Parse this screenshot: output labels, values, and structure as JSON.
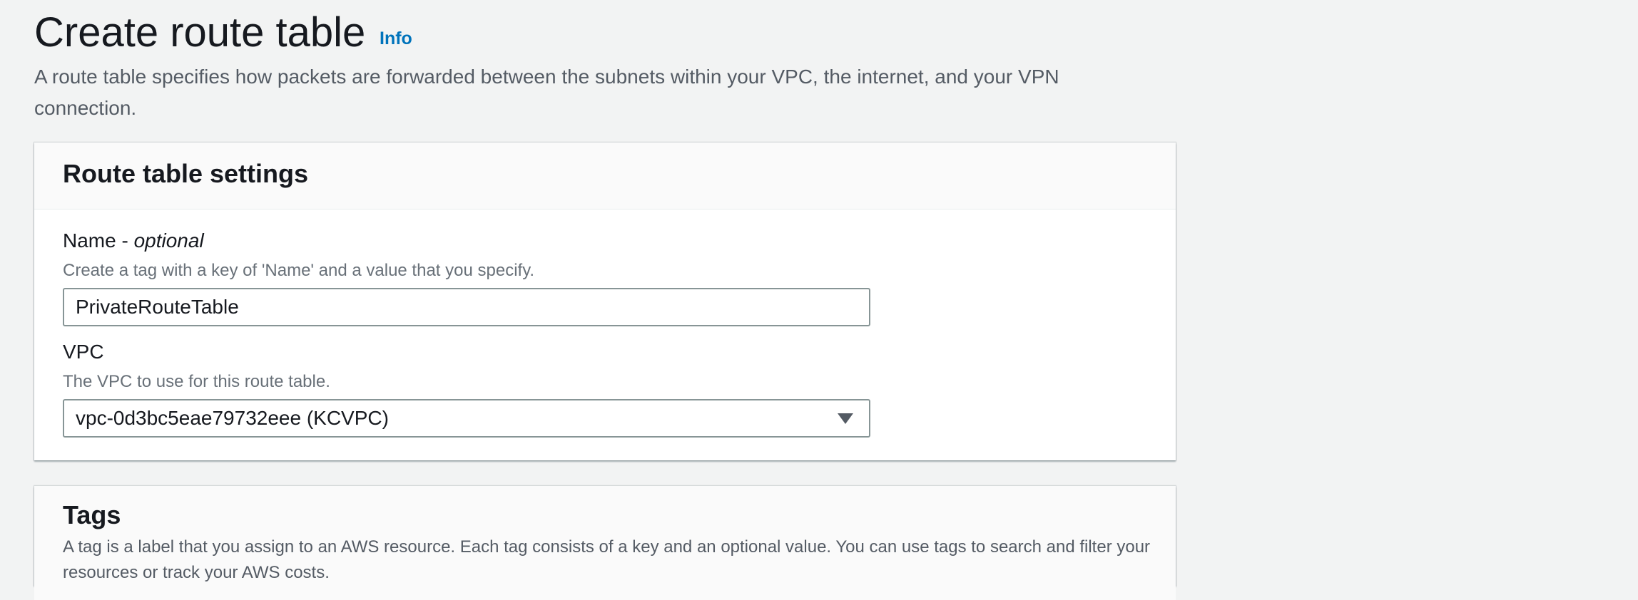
{
  "page": {
    "title": "Create route table",
    "info_link": "Info",
    "description": "A route table specifies how packets are forwarded between the subnets within your VPC, the internet, and your VPN connection."
  },
  "settings": {
    "header": "Route table settings",
    "name_field": {
      "label_main": "Name - ",
      "label_optional": "optional",
      "description": "Create a tag with a key of 'Name' and a value that you specify.",
      "value": "PrivateRouteTable"
    },
    "vpc_field": {
      "label": "VPC",
      "description": "The VPC to use for this route table.",
      "selected": "vpc-0d3bc5eae79732eee (KCVPC)"
    }
  },
  "tags": {
    "header": "Tags",
    "description": "A tag is a label that you assign to an AWS resource. Each tag consists of a key and an optional value. You can use tags to search and filter your resources or track your AWS costs."
  },
  "colors": {
    "page_background": "#f2f3f3",
    "link": "#0073bb",
    "text_primary": "#16191f",
    "text_secondary": "#545b64"
  },
  "icons": {
    "select_caret": "caret-down-icon"
  }
}
